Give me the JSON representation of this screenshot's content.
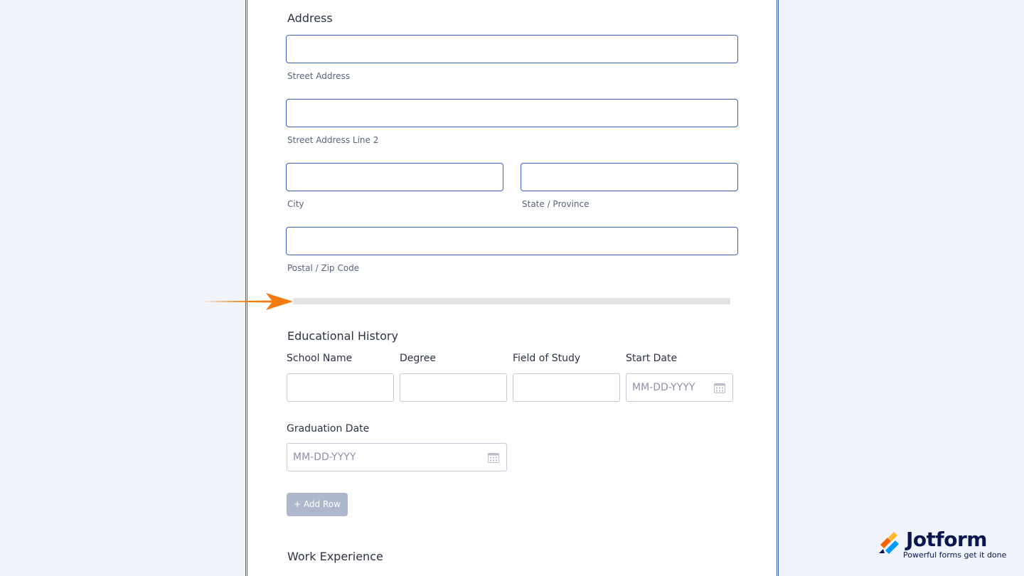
{
  "address": {
    "heading": "Address",
    "street_label": "Street Address",
    "street2_label": "Street Address Line 2",
    "city_label": "City",
    "state_label": "State / Province",
    "zip_label": "Postal / Zip Code"
  },
  "education": {
    "heading": "Educational History",
    "columns": [
      "School Name",
      "Degree",
      "Field of Study",
      "Start Date"
    ],
    "graduation_label": "Graduation Date",
    "date_placeholder": "MM-DD-YYYY",
    "add_row_label": "+ Add Row"
  },
  "work": {
    "heading": "Work Experience"
  },
  "branding": {
    "logo_name": "Jotform",
    "tagline": "Powerful forms get it done"
  },
  "colors": {
    "accent_border": "#3a62b8",
    "arrow": "#f27a0f",
    "background": "#f1f3fb",
    "button": "#aeb7cb"
  },
  "icons": {
    "calendar": "calendar-icon",
    "arrow": "arrow-right-icon",
    "logo": "jotform-logo-icon"
  }
}
